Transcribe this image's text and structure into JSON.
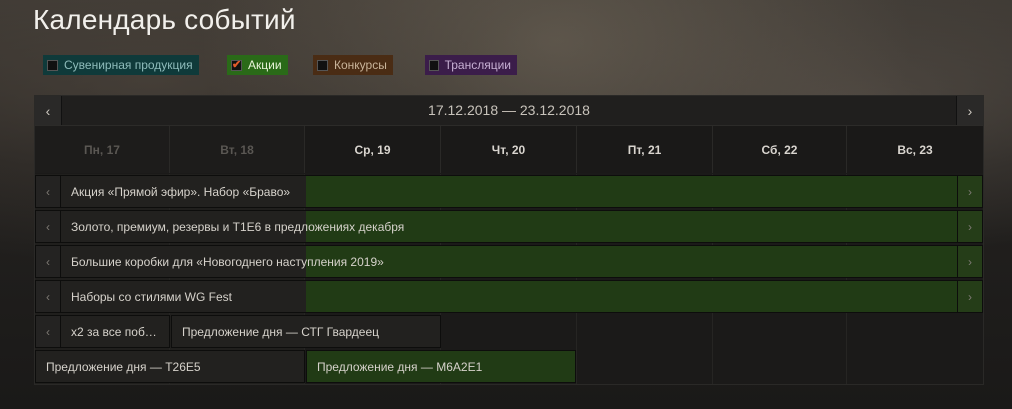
{
  "page_title": "Календарь событий",
  "filters": [
    {
      "label": "Сувенирная продукция",
      "checked": false,
      "color": "#0f3a3a"
    },
    {
      "label": "Акции",
      "checked": true,
      "color": "#2a6a18"
    },
    {
      "label": "Конкурсы",
      "checked": false,
      "color": "#4a2c14"
    },
    {
      "label": "Трансляции",
      "checked": false,
      "color": "#3b1d4a"
    }
  ],
  "week": {
    "range": "17.12.2018 — 23.12.2018",
    "prev_icon": "‹",
    "next_icon": "›",
    "days": [
      "Пн, 17",
      "Вт, 18",
      "Ср, 19",
      "Чт, 20",
      "Пт, 21",
      "Сб, 22",
      "Вс, 23"
    ]
  },
  "events": [
    {
      "title": "Акция «Прямой эфир». Набор «Браво»"
    },
    {
      "title": "Золото, премиум, резервы и Т1Е6 в предложениях декабря"
    },
    {
      "title": "Большие коробки для «Новогоднего наступления 2019»"
    },
    {
      "title": "Наборы со стилями WG Fest"
    },
    {
      "title": "x2 за все поб…"
    },
    {
      "title": "Предложение дня — СТГ Гвардеец"
    },
    {
      "title": "Предложение дня — T26E5"
    },
    {
      "title": "Предложение дня — M6A2E1"
    }
  ],
  "colors": {
    "promo_green": "#213b15",
    "accent_check": "#e05a2a"
  }
}
